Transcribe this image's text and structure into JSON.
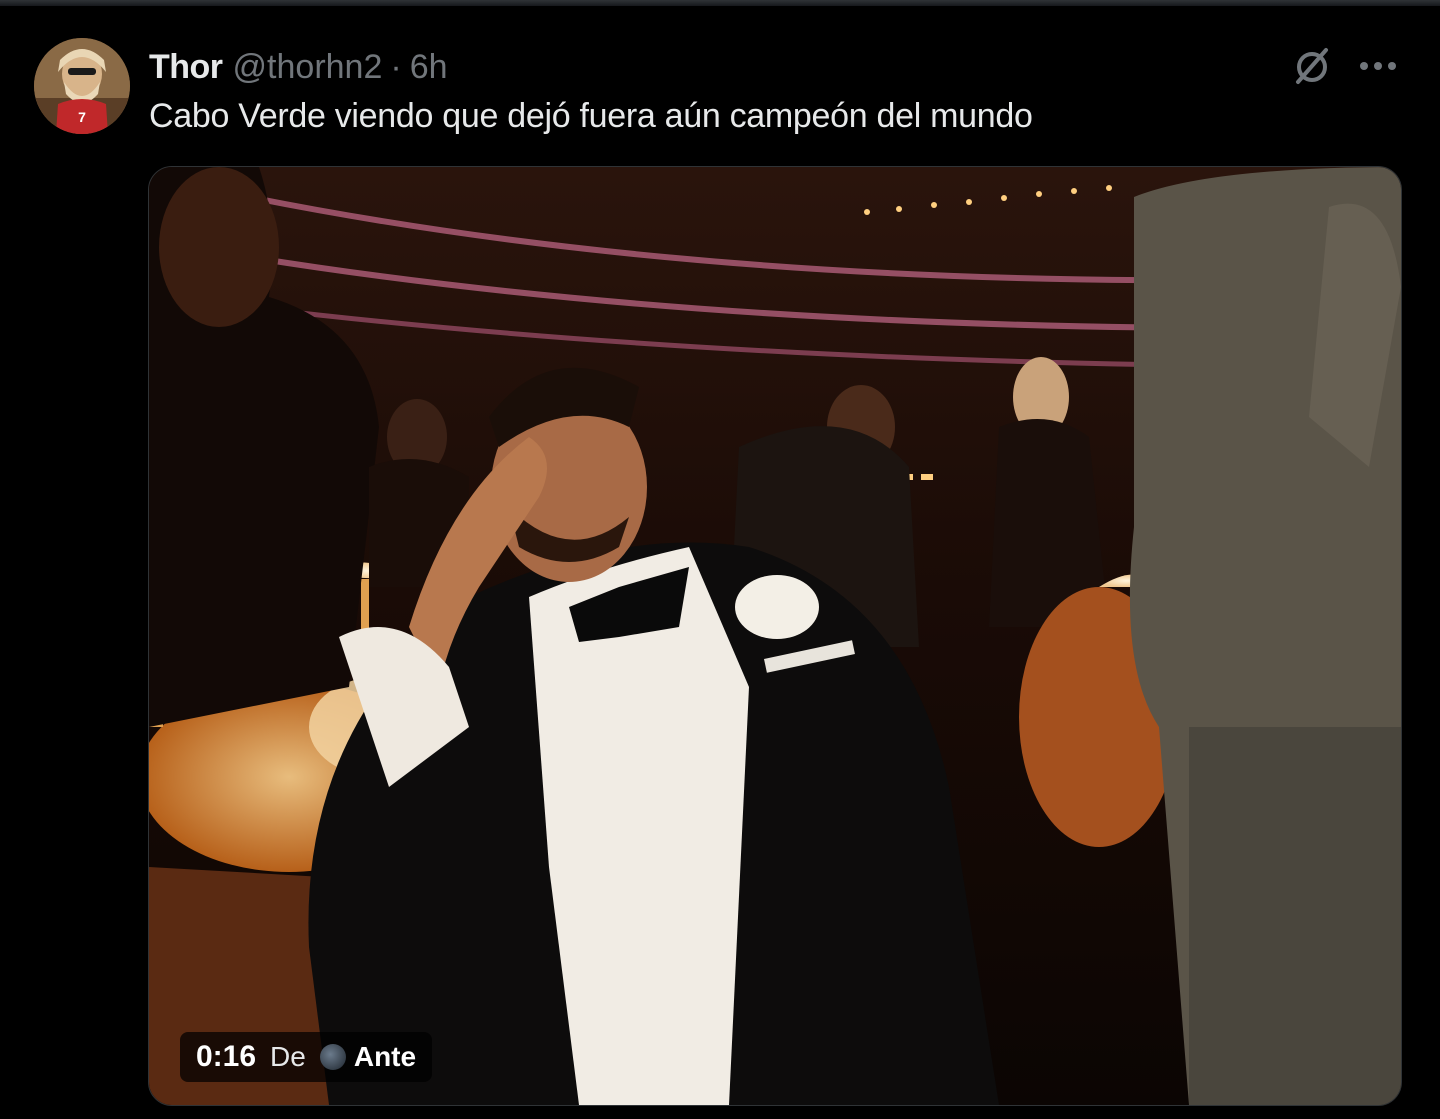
{
  "tweet": {
    "author": {
      "display_name": "Thor",
      "handle": "@thorhn2",
      "avatar_icon": "thor-avatar-icon",
      "avatar_jersey_number": "7"
    },
    "separator": "·",
    "time_ago": "6h",
    "text": "Cabo Verde viendo que dejó fuera aún campeón del mundo",
    "actions": {
      "grok_icon": "grok-icon",
      "more_icon": "more-horizontal-icon"
    },
    "media": {
      "kind": "video",
      "timestamp": "0:16",
      "from_label": "De",
      "source_icon": "source-avatar-icon",
      "source_name": "Ante"
    }
  },
  "colors": {
    "background": "#000000",
    "text_primary": "#e7e9ea",
    "text_secondary": "#71767b",
    "border": "#2f3336"
  }
}
